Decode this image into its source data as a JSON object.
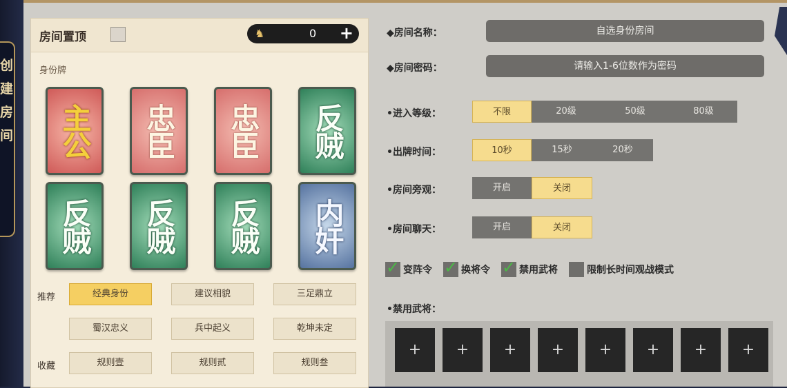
{
  "sidebar": {
    "vertical_title": "创建房间"
  },
  "left_panel": {
    "pin_label": "房间置顶",
    "coin_value": "0",
    "coin_add": "+",
    "section_title": "身份牌",
    "cards": [
      {
        "role": "主公",
        "variant": "lord"
      },
      {
        "role": "忠臣",
        "variant": "loyal"
      },
      {
        "role": "忠臣",
        "variant": "loyal"
      },
      {
        "role": "反贼",
        "variant": "rebel"
      },
      {
        "role": "反贼",
        "variant": "rebel"
      },
      {
        "role": "反贼",
        "variant": "rebel"
      },
      {
        "role": "反贼",
        "variant": "rebel"
      },
      {
        "role": "内奸",
        "variant": "spy"
      }
    ],
    "recommend_label": "推荐",
    "collect_label": "收藏",
    "recommend_options": [
      "经典身份",
      "建议相貌",
      "三足鼎立",
      "蜀汉忠义",
      "兵中起义",
      "乾坤未定"
    ],
    "collect_options": [
      "规则壹",
      "规则贰",
      "规则叁"
    ],
    "active_option": "经典身份"
  },
  "right_panel": {
    "room_name_label": "◆房间名称：",
    "room_name_value": "自选身份房间",
    "password_label": "◆房间密码：",
    "password_placeholder": "请输入1-6位数作为密码",
    "level_label": "•进入等级：",
    "level_options": [
      "不限",
      "20级",
      "50级",
      "80级"
    ],
    "level_selected": "不限",
    "time_label": "•出牌时间：",
    "time_options": [
      "10秒",
      "15秒",
      "20秒"
    ],
    "time_selected": "10秒",
    "spectate_label": "•房间旁观：",
    "spectate_options": [
      "开启",
      "关闭"
    ],
    "spectate_selected": "关闭",
    "chat_label": "•房间聊天：",
    "chat_options": [
      "开启",
      "关闭"
    ],
    "chat_selected": "关闭",
    "checkboxes": [
      {
        "label": "变阵令",
        "checked": true
      },
      {
        "label": "换将令",
        "checked": true
      },
      {
        "label": "禁用武将",
        "checked": true
      },
      {
        "label": "限制长时间观战模式",
        "checked": false
      }
    ],
    "ban_label": "•禁用武将：",
    "ban_slot_symbol": "+",
    "ban_slot_count": 8
  },
  "colors": {
    "gold": "#f5cf62",
    "rebel_green": "#2f8059",
    "lord_red": "#cf5a58",
    "spy_blue": "#5673a0"
  }
}
